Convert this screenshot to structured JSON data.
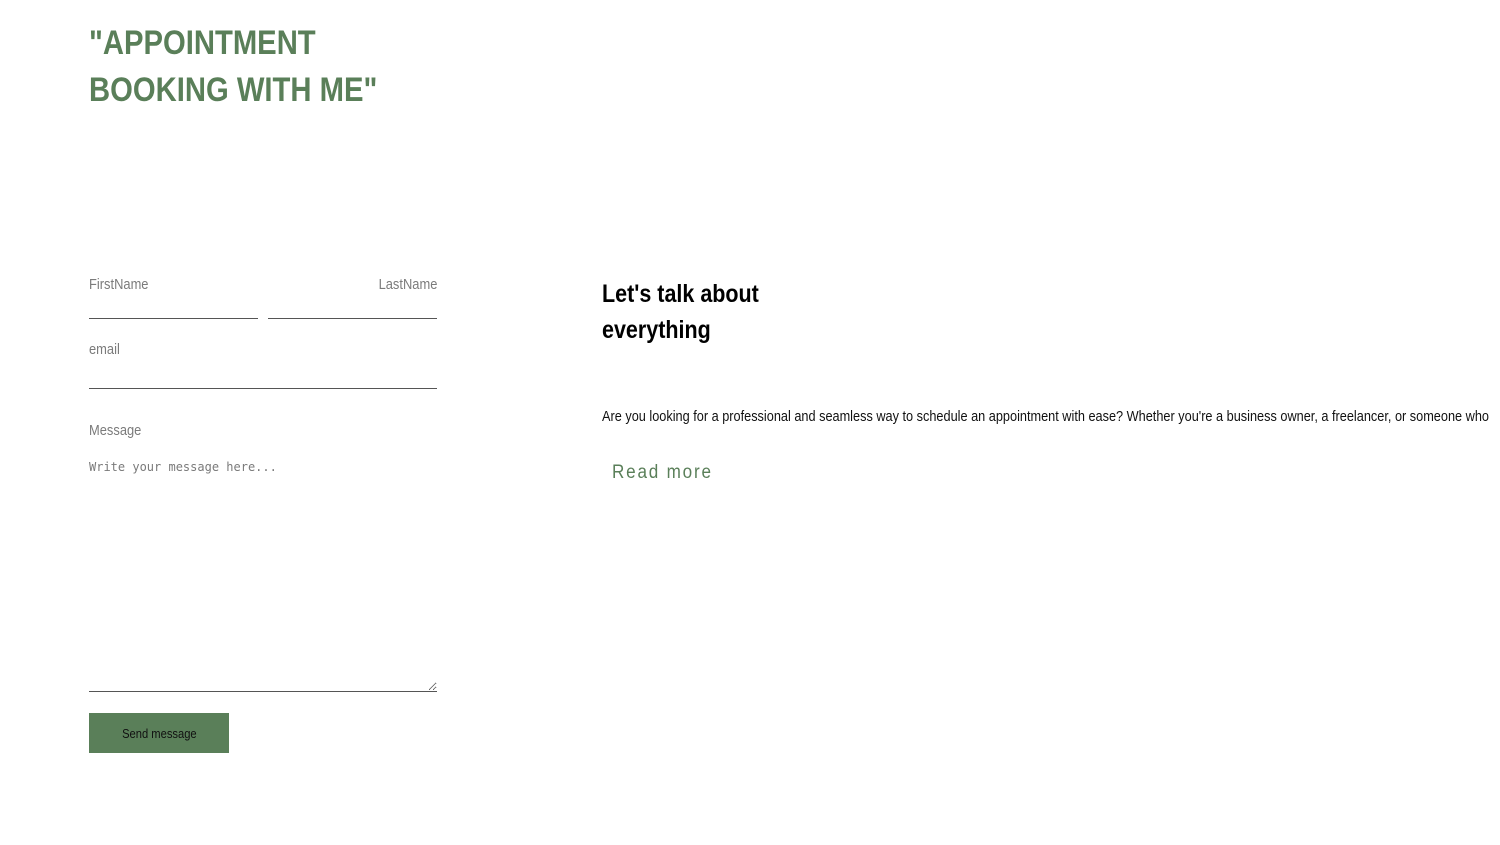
{
  "header": {
    "title": "\"APPOINTMENT BOOKING WITH ME\""
  },
  "form": {
    "first_name_label": "FirstName",
    "last_name_label": "LastName",
    "email_label": "email",
    "message_label": "Message",
    "message_placeholder": "Write your message here...",
    "send_label": "Send message"
  },
  "info": {
    "heading": "Let's talk about everything",
    "body": "Are you looking for a professional and seamless way to schedule an appointment with ease? Whether you're a business owner, a freelancer, or someone who",
    "read_more_label": "Read more"
  },
  "colors": {
    "accent": "#5a7f59",
    "text": "#111111",
    "label": "#7b7b7b"
  }
}
